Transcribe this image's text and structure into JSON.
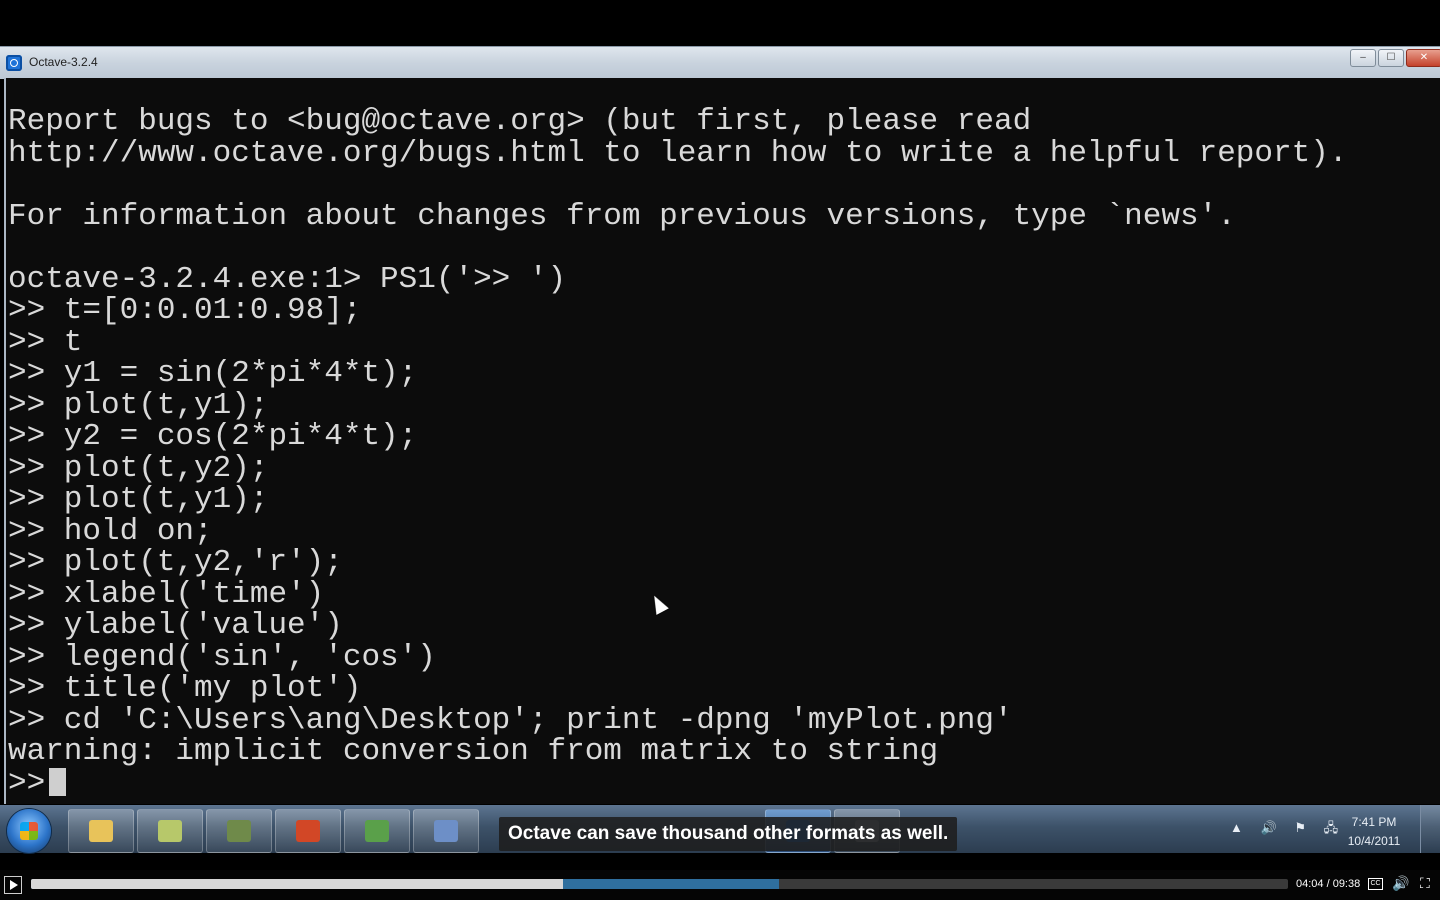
{
  "window": {
    "title": "Octave-3.2.4",
    "buttons": {
      "minimize": "–",
      "maximize": "☐",
      "close": "✕"
    }
  },
  "console": {
    "lines": [
      "Report bugs to <bug@octave.org> (but first, please read",
      "http://www.octave.org/bugs.html to learn how to write a helpful report).",
      "",
      "For information about changes from previous versions, type `news'.",
      "",
      "octave-3.2.4.exe:1> PS1('>> ')",
      ">> t=[0:0.01:0.98];",
      ">> t",
      ">> y1 = sin(2*pi*4*t);",
      ">> plot(t,y1);",
      ">> y2 = cos(2*pi*4*t);",
      ">> plot(t,y2);",
      ">> plot(t,y1);",
      ">> hold on;",
      ">> plot(t,y2,'r');",
      ">> xlabel('time')",
      ">> ylabel('value')",
      ">> legend('sin', 'cos')",
      ">> title('my plot')",
      ">> cd 'C:\\Users\\ang\\Desktop'; print -dpng 'myPlot.png'",
      "warning: implicit conversion from matrix to string"
    ],
    "prompt": ">>"
  },
  "taskbar": {
    "apps": [
      {
        "name": "explorer-icon",
        "color": "#e8c35a"
      },
      {
        "name": "notes-icon",
        "color": "#b7c86a"
      },
      {
        "name": "tools-icon",
        "color": "#6f8a4a"
      },
      {
        "name": "powerpoint-icon",
        "color": "#d24726"
      },
      {
        "name": "network-icon",
        "color": "#5aa04a"
      },
      {
        "name": "remote-desktop-icon",
        "color": "#6d8fc7"
      },
      {
        "name": "octave-icon",
        "color": "#1e73d8"
      },
      {
        "name": "window-icon",
        "color": "#9aa6b2"
      }
    ],
    "tray": {
      "chevron": "▲",
      "volume": "🔊",
      "flag": "⚑",
      "network": "🖧"
    },
    "clock": {
      "time": "7:41 PM",
      "date": "10/4/2011"
    }
  },
  "caption": "Octave can save thousand other formats as well.",
  "player": {
    "time": "04:04 / 09:38",
    "played_fraction": 0.423,
    "buffered_fraction": 0.595,
    "cc_label": "CC",
    "volume_icon": "🔊",
    "fullscreen_icon": "⛶"
  }
}
